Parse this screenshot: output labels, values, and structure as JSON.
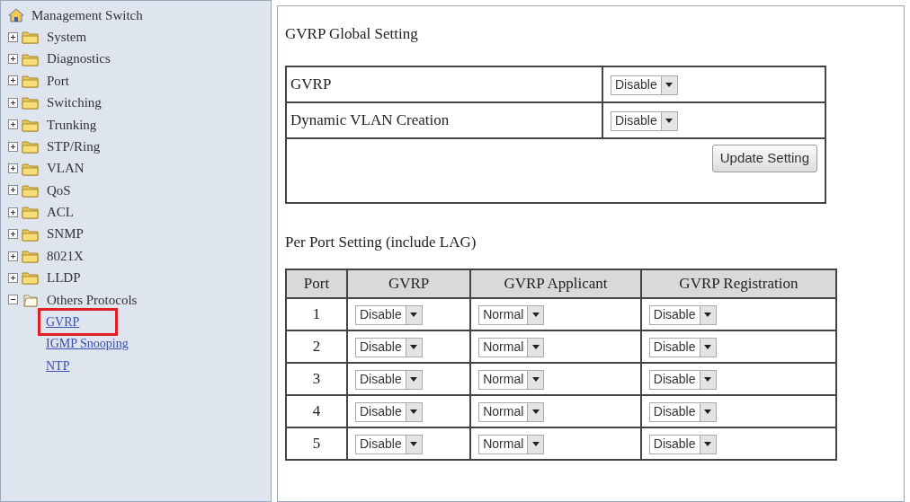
{
  "sidebar": {
    "root": "Management Switch",
    "items": [
      {
        "label": "System",
        "expanded": false
      },
      {
        "label": "Diagnostics",
        "expanded": false
      },
      {
        "label": "Port",
        "expanded": false
      },
      {
        "label": "Switching",
        "expanded": false
      },
      {
        "label": "Trunking",
        "expanded": false
      },
      {
        "label": "STP/Ring",
        "expanded": false
      },
      {
        "label": "VLAN",
        "expanded": false
      },
      {
        "label": "QoS",
        "expanded": false
      },
      {
        "label": "ACL",
        "expanded": false
      },
      {
        "label": "SNMP",
        "expanded": false
      },
      {
        "label": "8021X",
        "expanded": false
      },
      {
        "label": "LLDP",
        "expanded": false
      },
      {
        "label": "Others Protocols",
        "expanded": true,
        "children": [
          {
            "label": "GVRP",
            "highlighted": true
          },
          {
            "label": "IGMP Snooping",
            "highlighted": false
          },
          {
            "label": "NTP",
            "highlighted": false
          }
        ]
      }
    ]
  },
  "global": {
    "title": "GVRP Global Setting",
    "rows": [
      {
        "label": "GVRP",
        "value": "Disable"
      },
      {
        "label": "Dynamic VLAN Creation",
        "value": "Disable"
      }
    ],
    "button": "Update Setting"
  },
  "per_port": {
    "title": "Per Port Setting (include LAG)",
    "columns": [
      "Port",
      "GVRP",
      "GVRP Applicant",
      "GVRP Registration"
    ],
    "rows": [
      {
        "port": "1",
        "gvrp": "Disable",
        "applicant": "Normal",
        "registration": "Disable"
      },
      {
        "port": "2",
        "gvrp": "Disable",
        "applicant": "Normal",
        "registration": "Disable"
      },
      {
        "port": "3",
        "gvrp": "Disable",
        "applicant": "Normal",
        "registration": "Disable"
      },
      {
        "port": "4",
        "gvrp": "Disable",
        "applicant": "Normal",
        "registration": "Disable"
      },
      {
        "port": "5",
        "gvrp": "Disable",
        "applicant": "Normal",
        "registration": "Disable"
      }
    ]
  }
}
